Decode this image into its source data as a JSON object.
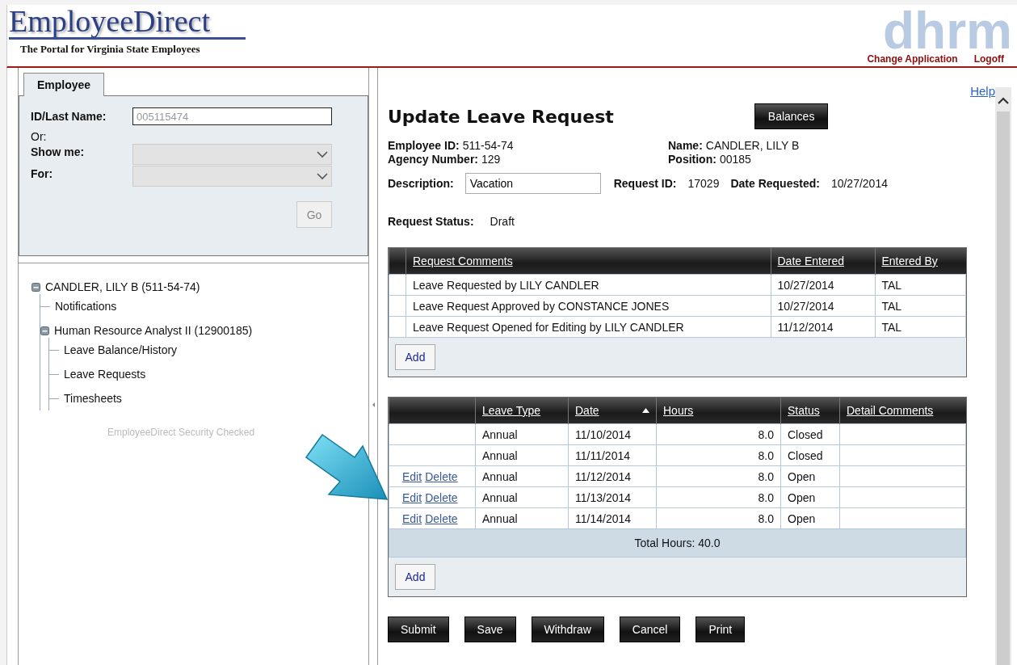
{
  "header": {
    "logo_title": "EmployeeDirect",
    "logo_tagline": "The Portal for Virginia State Employees",
    "watermark_logo": "dhrm",
    "links": [
      "Change Application",
      "Logoff"
    ]
  },
  "search_panel": {
    "tabs": [
      {
        "label": "Employee",
        "selected": true
      }
    ],
    "id_field": {
      "label": "ID/Last Name:",
      "placeholder": "005115474"
    },
    "or_label": "Or:",
    "selects": [
      {
        "label": "Show me:",
        "disabled": true
      },
      {
        "label": "For:",
        "disabled": true
      }
    ],
    "go_button": {
      "label": "Go",
      "disabled": true
    }
  },
  "tree": [
    {
      "label": "CANDLER, LILY B (511-54-74)",
      "expanded": true,
      "children": [
        {
          "label": "Notifications"
        },
        {
          "label": "Human Resource Analyst II (12900185)",
          "expanded": true,
          "children": [
            {
              "label": "Leave Balance/History"
            },
            {
              "label": "Leave Requests"
            },
            {
              "label": "Timesheets"
            }
          ]
        }
      ]
    }
  ],
  "security_note": "EmployeeDirect Security Checked",
  "help_link": "Help",
  "form": {
    "title": "Update Leave Request",
    "balances_button": "Balances",
    "fields_left": [
      {
        "label": "Employee ID:",
        "value": "511-54-74"
      },
      {
        "label": "Agency Number:",
        "value": "129"
      }
    ],
    "fields_right": [
      {
        "label": "Name:",
        "value": "CANDLER, LILY B"
      },
      {
        "label": "Position:",
        "value": "00185"
      }
    ],
    "description": {
      "label": "Description:",
      "value": "Vacation"
    },
    "request_id": {
      "label": "Request ID:",
      "value": "17029"
    },
    "date_requested": {
      "label": "Date Requested:",
      "value": "10/27/2014"
    },
    "request_status": {
      "label": "Request Status:",
      "value": "Draft"
    }
  },
  "comments_table": {
    "columns": [
      "Request Comments",
      "Date Entered",
      "Entered By"
    ],
    "rows": [
      [
        "Leave Requested by LILY CANDLER",
        "10/27/2014",
        "TAL"
      ],
      [
        "Leave Request Approved by CONSTANCE JONES",
        "10/27/2014",
        "TAL"
      ],
      [
        "Leave Request Opened for Editing by LILY CANDLER",
        "11/12/2014",
        "TAL"
      ]
    ],
    "add_button": "Add"
  },
  "leave_table": {
    "columns": [
      {
        "label": "Leave Type",
        "sorted": false
      },
      {
        "label": "Date",
        "sorted": true
      },
      {
        "label": "Hours",
        "sorted": false
      },
      {
        "label": "Status",
        "sorted": false
      },
      {
        "label": "Detail Comments",
        "sorted": false
      }
    ],
    "rows": [
      {
        "actions": [],
        "leave_type": "Annual",
        "date": "11/10/2014",
        "hours": "8.0",
        "status": "Closed"
      },
      {
        "actions": [],
        "leave_type": "Annual",
        "date": "11/11/2014",
        "hours": "8.0",
        "status": "Closed"
      },
      {
        "actions": [
          "Edit",
          "Delete"
        ],
        "leave_type": "Annual",
        "date": "11/12/2014",
        "hours": "8.0",
        "status": "Open"
      },
      {
        "actions": [
          "Edit",
          "Delete"
        ],
        "leave_type": "Annual",
        "date": "11/13/2014",
        "hours": "8.0",
        "status": "Open"
      },
      {
        "actions": [
          "Edit",
          "Delete"
        ],
        "leave_type": "Annual",
        "date": "11/14/2014",
        "hours": "8.0",
        "status": "Open"
      }
    ],
    "total": "Total Hours: 40.0",
    "add_button": "Add"
  },
  "action_buttons": [
    "Submit",
    "Save",
    "Withdraw",
    "Cancel",
    "Print"
  ]
}
